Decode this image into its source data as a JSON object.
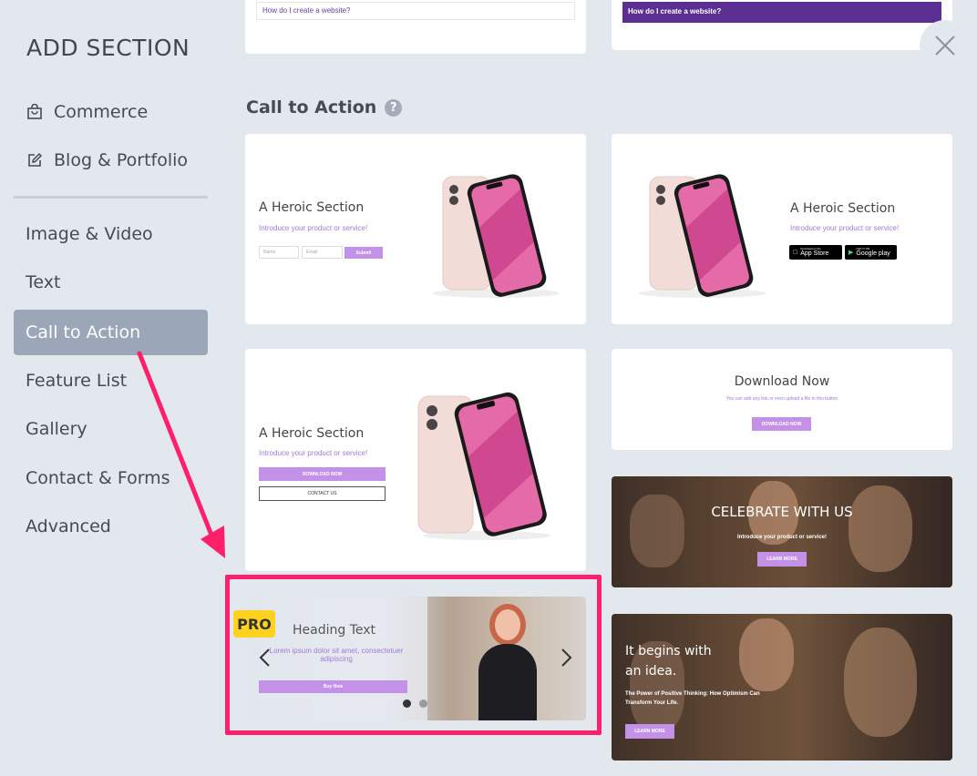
{
  "sidebar": {
    "title": "ADD SECTION",
    "top_items": [
      {
        "label": "Commerce",
        "icon": "shopping-bag-icon"
      },
      {
        "label": "Blog & Portfolio",
        "icon": "edit-icon"
      }
    ],
    "items": [
      {
        "label": "Image & Video"
      },
      {
        "label": "Text"
      },
      {
        "label": "Call to Action",
        "active": true
      },
      {
        "label": "Feature List"
      },
      {
        "label": "Gallery"
      },
      {
        "label": "Contact & Forms"
      },
      {
        "label": "Advanced"
      }
    ]
  },
  "prev_cards": {
    "faq_left": "How do I create a website?",
    "faq_right": "How do I create a website?"
  },
  "section": {
    "title": "Call to Action",
    "help_icon": "question-icon"
  },
  "cards": {
    "hero_form": {
      "title": "A Heroic Section",
      "subtitle": "Introduce your product or service!",
      "name_placeholder": "Name",
      "email_placeholder": "Email",
      "submit": "Submit"
    },
    "hero_store": {
      "title": "A Heroic Section",
      "subtitle": "Introduce your product or service!",
      "app_store_small": "Download on the",
      "app_store": "App Store",
      "google_play_small": "GET IT ON",
      "google_play": "Google play"
    },
    "hero_download": {
      "title": "A Heroic Section",
      "subtitle": "Introduce your product or service!",
      "primary": "DOWNLOAD NOW",
      "secondary": "CONTACT US"
    },
    "download_now": {
      "title": "Download Now",
      "subtitle": "You can add any link or even upload a file to this button",
      "button": "DOWNLOAD NOW"
    },
    "celebrate": {
      "title": "CELEBRATE WITH US",
      "subtitle": "Introduce your product or service!",
      "button": "LEARN MORE"
    },
    "slider": {
      "badge": "PRO",
      "title": "Heading Text",
      "body": "Lorem ipsum dolor sit amet, consectetuer adipiscing",
      "button": "Buy Now"
    },
    "idea": {
      "title_line1": "It begins with",
      "title_line2": "an idea.",
      "body_line1": "The Power of Positive Thinking: How Optimism Can",
      "body_line2": "Transform Your Life.",
      "button": "LEARN MORE"
    }
  },
  "colors": {
    "accent_purple": "#c491e9",
    "highlight": "#ff1f6a",
    "active_nav": "#9ba7b9",
    "pro_badge": "#ffd21f"
  }
}
